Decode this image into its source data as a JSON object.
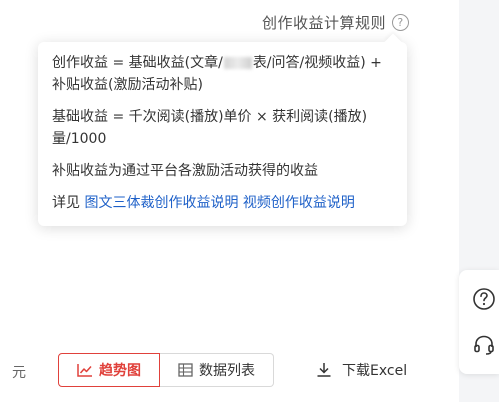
{
  "header": {
    "rules_link": "创作收益计算规则",
    "help_glyph": "?"
  },
  "popover": {
    "formula1_part1": "创作收益 = 基础收益(文章/",
    "formula1_part2": "表/问答/视频收益) +",
    "formula1_line2": "补贴收益(激励活动补贴)",
    "formula2_line1": "基础收益 = 千次阅读(播放)单价 × 获利阅读(播放)",
    "formula2_line2": "量/1000",
    "subsidy_desc": "补贴收益为通过平台各激励活动获得的收益",
    "see_prefix": "详见",
    "link_text_article": "图文三体裁创作收益说明",
    "link_text_video": "视频创作收益说明"
  },
  "toolbar": {
    "unit": "元",
    "tab_trend": "趋势图",
    "tab_list": "数据列表",
    "export": "下载Excel"
  },
  "side": {
    "help_icon": "question-circle-icon",
    "service_icon": "headset-icon"
  },
  "colors": {
    "accent": "#e0413b",
    "link": "#1e60c8"
  }
}
